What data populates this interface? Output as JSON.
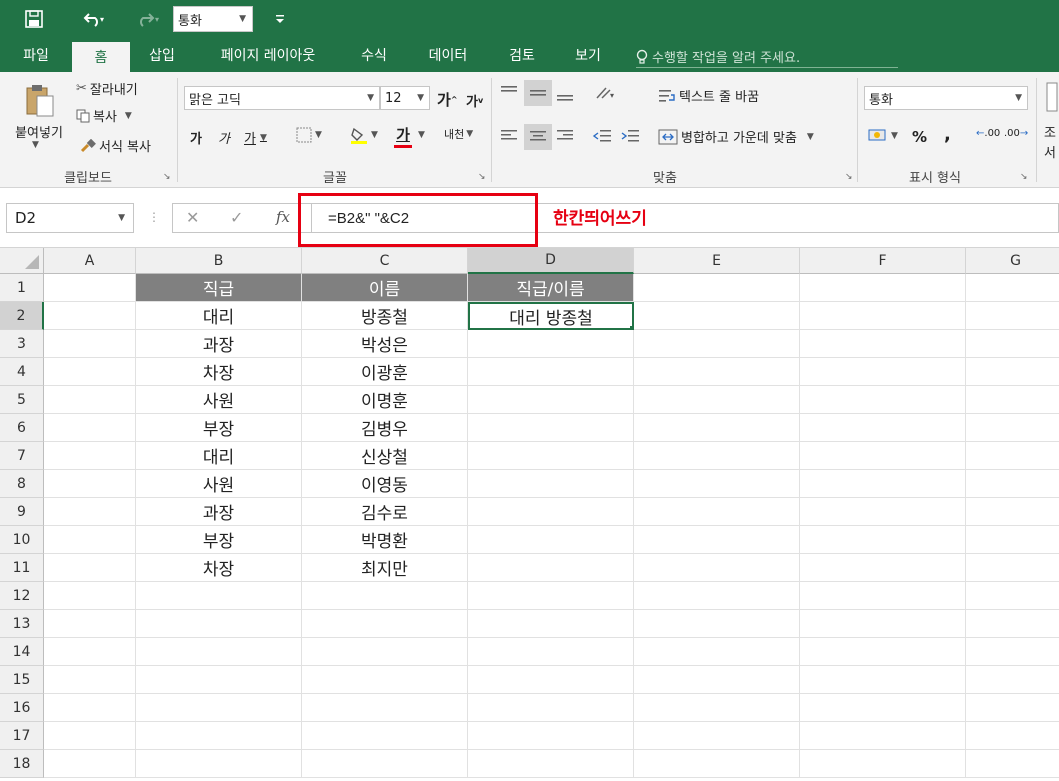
{
  "quick_access": {
    "font_box": "통화"
  },
  "tabs": [
    "파일",
    "홈",
    "삽입",
    "페이지 레이아웃",
    "수식",
    "데이터",
    "검토",
    "보기"
  ],
  "tell_me": "수행할 작업을 알려 주세요.",
  "ribbon": {
    "clipboard": {
      "paste": "붙여넣기",
      "cut": "잘라내기",
      "copy": "복사",
      "format_painter": "서식 복사",
      "label": "클립보드"
    },
    "font": {
      "name": "맑은 고딕",
      "size": "12",
      "bold": "가",
      "italic": "가",
      "underline": "가",
      "color_letter": "가",
      "phonetic": "내천",
      "label": "글꼴"
    },
    "alignment": {
      "wrap_text": "텍스트 줄 바꿈",
      "merge_center": "병합하고 가운데 맞춤",
      "label": "맞춤"
    },
    "number": {
      "format": "통화",
      "percent": "%",
      "comma": ",",
      "inc_decimal": ".00",
      "dec_decimal": ".00",
      "label": "표시 형식"
    },
    "styles": {
      "cond_1": "조",
      "cond_2": "서"
    }
  },
  "formula_bar": {
    "name_box": "D2",
    "fx": "fx",
    "formula": "=B2&\" \"&C2",
    "annotation": "한칸띄어쓰기"
  },
  "columns": [
    "A",
    "B",
    "C",
    "D",
    "E",
    "F",
    "G"
  ],
  "rows": [
    "1",
    "2",
    "3",
    "4",
    "5",
    "6",
    "7",
    "8",
    "9",
    "10",
    "11",
    "12",
    "13",
    "14",
    "15",
    "16",
    "17",
    "18"
  ],
  "table": {
    "headers": [
      "직급",
      "이름",
      "직급/이름"
    ],
    "rows": [
      [
        "대리",
        "방종철",
        "대리 방종철"
      ],
      [
        "과장",
        "박성은",
        ""
      ],
      [
        "차장",
        "이광훈",
        ""
      ],
      [
        "사원",
        "이명훈",
        ""
      ],
      [
        "부장",
        "김병우",
        ""
      ],
      [
        "대리",
        "신상철",
        ""
      ],
      [
        "사원",
        "이영동",
        ""
      ],
      [
        "과장",
        "김수로",
        ""
      ],
      [
        "부장",
        "박명환",
        ""
      ],
      [
        "차장",
        "최지만",
        ""
      ]
    ]
  },
  "colors": {
    "excel_green": "#217346",
    "header_fill": "#808080",
    "annotation_red": "#e60012"
  }
}
